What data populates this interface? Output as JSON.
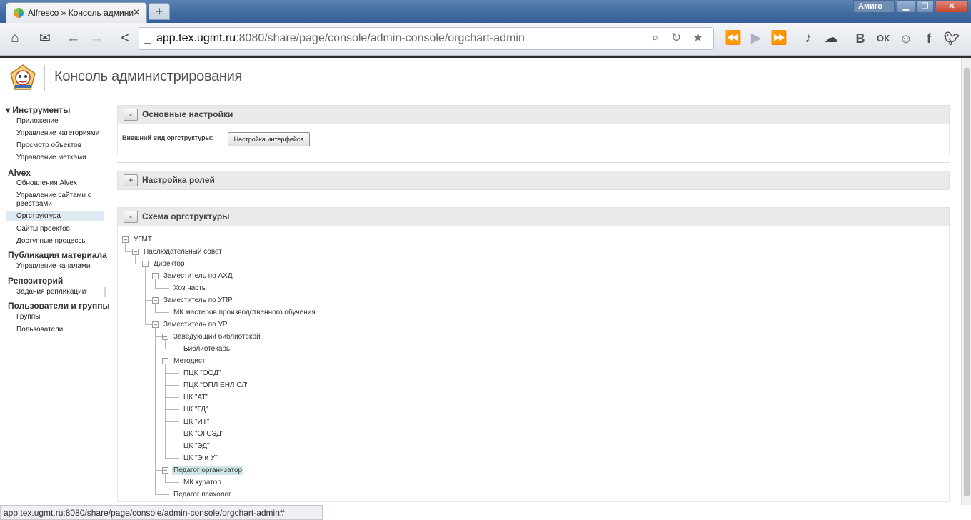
{
  "browser": {
    "tab_title": "Alfresco » Консоль админи",
    "tab_close": "✕",
    "new_tab": "+",
    "profile_name": "Амиго",
    "url_host": "app.tex.ugmt.ru",
    "url_rest": ":8080/share/page/console/admin-console/orgchart-admin",
    "status_url": "app.tex.ugmt.ru:8080/share/page/console/admin-console/orgchart-admin#",
    "social": [
      "В",
      "ОК",
      "f"
    ]
  },
  "header": {
    "title": "Консоль администрирования"
  },
  "sidebar": {
    "groups": [
      {
        "title": "▾ Инструменты",
        "items": [
          "Приложение",
          "Управление категориями",
          "Просмотр объектов",
          "Управление метками"
        ]
      },
      {
        "title": "Alvex",
        "items": [
          "Обновления Alvex",
          "Управление сайтами с реестрами",
          "Оргструктура",
          "Сайты проектов",
          "Доступные процессы"
        ]
      },
      {
        "title": "Публикация материала",
        "items": [
          "Управление каналами"
        ]
      },
      {
        "title": "Репозиторий",
        "items": [
          "Задания репликации"
        ]
      },
      {
        "title": "Пользователи и группы",
        "items": [
          "Группы",
          "Пользователи"
        ]
      }
    ],
    "reestr_line1": "Управление сайтами с",
    "reestr_line2": "реестрами",
    "selected": "Оргструктура"
  },
  "panels": {
    "basic": {
      "toggle": "-",
      "title": "Основные настройки",
      "field_label": "Внешний вид оргструктуры:",
      "button": "Настройка интерфейса"
    },
    "roles": {
      "toggle": "+",
      "title": "Настройка ролей"
    },
    "scheme": {
      "toggle": "-",
      "title": "Схема оргструктуры"
    }
  },
  "tree": [
    {
      "label": "УГМТ",
      "level": 0,
      "expandable": true
    },
    {
      "label": "Наблюдательный совет",
      "level": 1,
      "expandable": true
    },
    {
      "label": "Директор",
      "level": 2,
      "expandable": true
    },
    {
      "label": "Заместитель по АХД",
      "level": 3,
      "expandable": true
    },
    {
      "label": "Хоз часть",
      "level": 4,
      "expandable": false
    },
    {
      "label": "Заместитель по УПР",
      "level": 3,
      "expandable": true
    },
    {
      "label": "МК мастеров производственного обучения",
      "level": 4,
      "expandable": false
    },
    {
      "label": "Заместитель по УР",
      "level": 3,
      "expandable": true
    },
    {
      "label": "Заведующий библиотекой",
      "level": 4,
      "expandable": true
    },
    {
      "label": "Библиотекарь",
      "level": 5,
      "expandable": false
    },
    {
      "label": "Методист",
      "level": 4,
      "expandable": true
    },
    {
      "label": "ПЦК \"ООД\"",
      "level": 5,
      "expandable": false
    },
    {
      "label": "ПЦК \"ОПЛ ЕНЛ СЛ\"",
      "level": 5,
      "expandable": false
    },
    {
      "label": "ЦК \"АТ\"",
      "level": 5,
      "expandable": false
    },
    {
      "label": "ЦК \"ГД\"",
      "level": 5,
      "expandable": false
    },
    {
      "label": "ЦК \"ИТ\"",
      "level": 5,
      "expandable": false
    },
    {
      "label": "ЦК \"ОГСЭД\"",
      "level": 5,
      "expandable": false
    },
    {
      "label": "ЦК \"ЭД\"",
      "level": 5,
      "expandable": false
    },
    {
      "label": "ЦК \"Э и У\"",
      "level": 5,
      "expandable": false
    },
    {
      "label": "Педагог организатор",
      "level": 4,
      "expandable": true,
      "highlighted": true
    },
    {
      "label": "МК куратор",
      "level": 5,
      "expandable": false
    },
    {
      "label": "Педагог психолог",
      "level": 4,
      "expandable": false
    }
  ]
}
